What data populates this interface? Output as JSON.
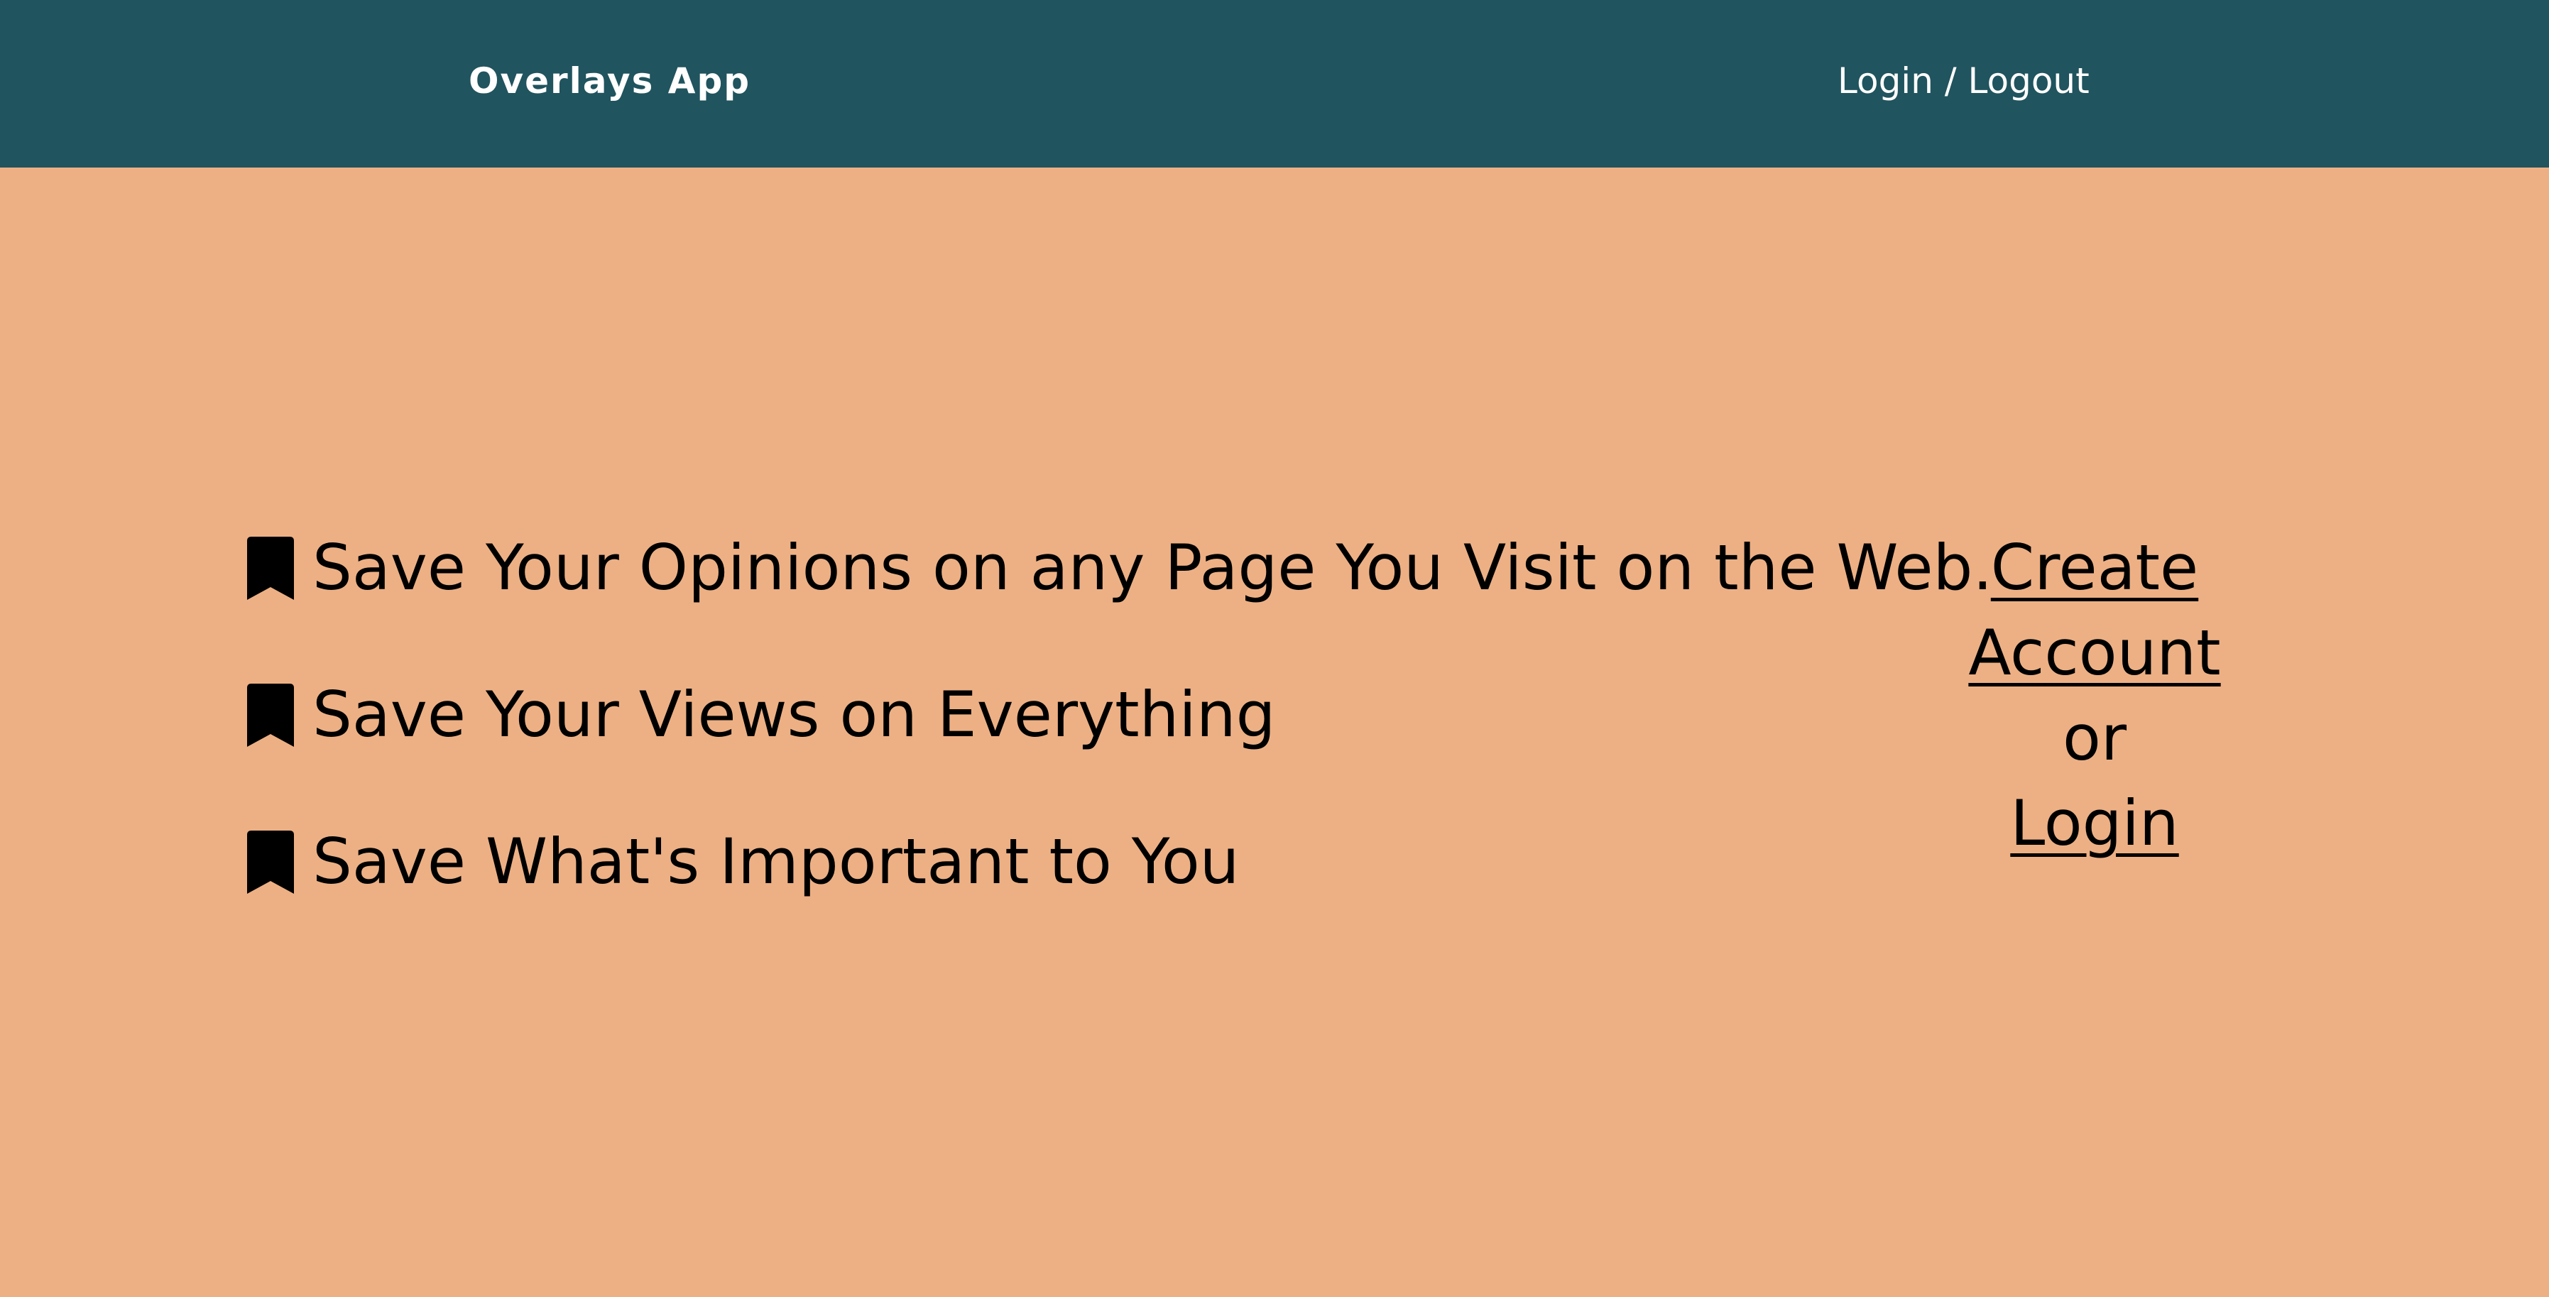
{
  "header": {
    "brand": "Overlays App",
    "nav_link": "Login / Logout"
  },
  "features": [
    {
      "icon": "bookmark-icon",
      "text": "Save Your Opinions on any Page You Visit on the Web."
    },
    {
      "icon": "bookmark-icon",
      "text": "Save Your Views on Everything"
    },
    {
      "icon": "bookmark-icon",
      "text": "Save What's Important to You"
    }
  ],
  "cta": {
    "create_line1": "Create",
    "create_line2": "Account",
    "or": "or",
    "login": "Login"
  },
  "colors": {
    "header_bg": "#20545e",
    "page_bg": "#edb084",
    "text": "#000000",
    "header_text": "#ffffff"
  }
}
